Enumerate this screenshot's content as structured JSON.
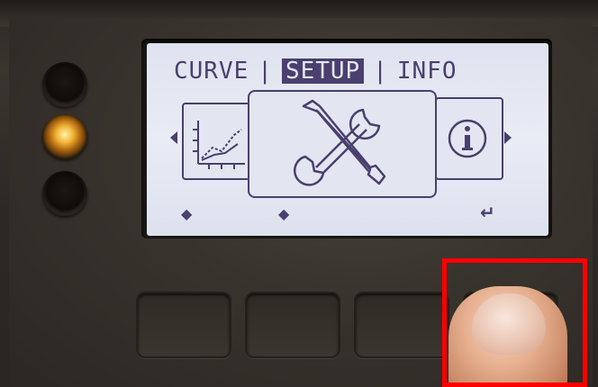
{
  "display": {
    "tabs": [
      {
        "label": "CURVE",
        "active": false
      },
      {
        "label": "SETUP",
        "active": true
      },
      {
        "label": "INFO",
        "active": false
      }
    ],
    "separator": "|",
    "cards": {
      "left_icon": "chart-icon",
      "center_icon": "tools-icon",
      "right_icon": "info-icon"
    },
    "softkeys": {
      "left_hint": "◆",
      "right_hint": "◆",
      "enter_hint": "↵"
    }
  },
  "indicators": [
    {
      "name": "led-top",
      "state": "off"
    },
    {
      "name": "led-middle",
      "state": "on"
    },
    {
      "name": "led-bottom",
      "state": "off"
    }
  ],
  "buttons": [
    "button-1",
    "button-2",
    "button-3",
    "button-4"
  ],
  "highlight": {
    "color": "#ff0000",
    "target": "button-4"
  },
  "colors": {
    "lcd_ink": "#4a3f6e",
    "lcd_background": "#e3e6f0",
    "device_body": "#38332d"
  }
}
